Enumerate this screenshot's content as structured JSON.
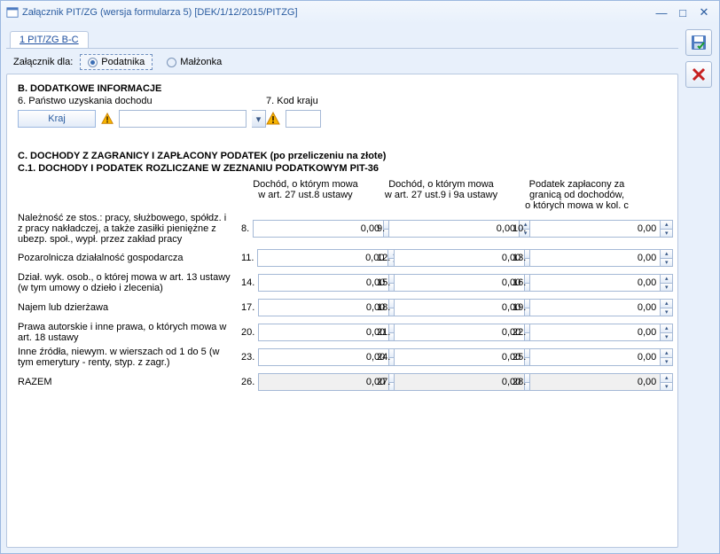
{
  "window": {
    "title": "Załącznik PIT/ZG (wersja formularza 5) [DEK/1/12/2015/PITZG]"
  },
  "tabs": {
    "tab1": "1 PIT/ZG B-C"
  },
  "filter": {
    "label": "Załącznik dla:",
    "opt1": "Podatnika",
    "opt2": "Małżonka"
  },
  "secB": {
    "title": "B. DODATKOWE INFORMACJE",
    "q6": "6. Państwo uzyskania dochodu",
    "q7": "7. Kod kraju",
    "kraj_btn": "Kraj"
  },
  "secC": {
    "title": "C. DOCHODY Z ZAGRANICY I ZAPŁACONY PODATEK (po przeliczeniu na złote)",
    "sub": "C.1. DOCHODY I PODATEK ROZLICZANE W ZEZNANIU PODATKOWYM PIT-36",
    "col1a": "Dochód, o którym mowa",
    "col1b": "w art. 27 ust.8 ustawy",
    "col2a": "Dochód, o którym mowa",
    "col2b": "w art. 27 ust.9 i 9a ustawy",
    "col3a": "Podatek zapłacony za",
    "col3b": "granicą od dochodów,",
    "col3c": "o których mowa w kol. c"
  },
  "rows": [
    {
      "desc": "Należność ze stos.: pracy, służbowego, spółdz. i z pracy nakładczej, a także zasiłki pieniężne z ubezp. społ., wypł. przez zakład pracy",
      "n": [
        "8.",
        "9.",
        "10."
      ],
      "v": [
        "0,00",
        "0,00",
        "0,00"
      ]
    },
    {
      "desc": "Pozarolnicza działalność gospodarcza",
      "n": [
        "11.",
        "12.",
        "13."
      ],
      "v": [
        "0,00",
        "0,00",
        "0,00"
      ]
    },
    {
      "desc": "Dział. wyk. osob., o której mowa w art. 13 ustawy (w tym umowy o dzieło i zlecenia)",
      "n": [
        "14.",
        "15.",
        "16."
      ],
      "v": [
        "0,00",
        "0,00",
        "0,00"
      ]
    },
    {
      "desc": "Najem lub dzierżawa",
      "n": [
        "17.",
        "18.",
        "19."
      ],
      "v": [
        "0,00",
        "0,00",
        "0,00"
      ]
    },
    {
      "desc": "Prawa autorskie i inne prawa, o których mowa w art. 18 ustawy",
      "n": [
        "20.",
        "21.",
        "22."
      ],
      "v": [
        "0,00",
        "0,00",
        "0,00"
      ]
    },
    {
      "desc": "Inne źródła, niewym. w wierszach od 1 do 5 (w tym emerytury - renty, styp. z zagr.)",
      "n": [
        "23.",
        "24.",
        "25."
      ],
      "v": [
        "0,00",
        "0,00",
        "0,00"
      ]
    },
    {
      "desc": "RAZEM",
      "n": [
        "26.",
        "27.",
        "28."
      ],
      "v": [
        "0,00",
        "0,00",
        "0,00"
      ],
      "total": true
    }
  ]
}
